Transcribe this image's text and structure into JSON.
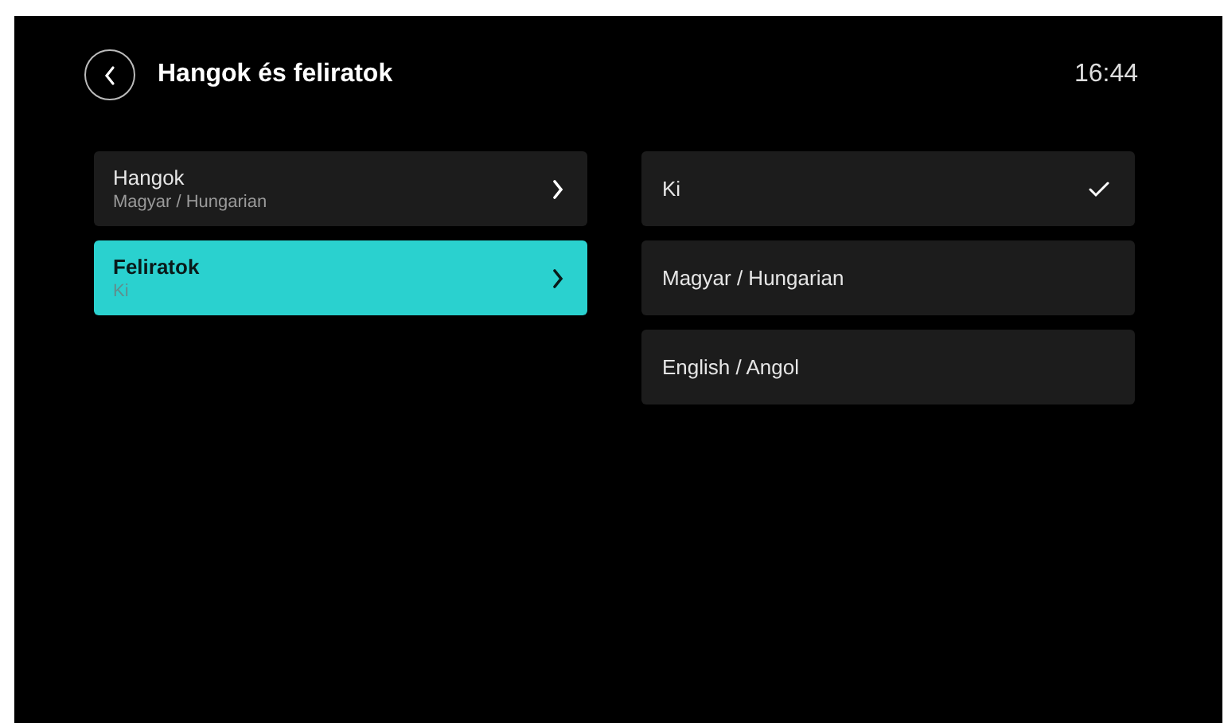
{
  "header": {
    "title": "Hangok és feliratok",
    "time": "16:44"
  },
  "menu": [
    {
      "label": "Hangok",
      "value": "Magyar / Hungarian",
      "selected": false
    },
    {
      "label": "Feliratok",
      "value": "Ki",
      "selected": true
    }
  ],
  "options": [
    {
      "label": "Ki",
      "checked": true
    },
    {
      "label": "Magyar / Hungarian",
      "checked": false
    },
    {
      "label": "English / Angol",
      "checked": false
    }
  ]
}
